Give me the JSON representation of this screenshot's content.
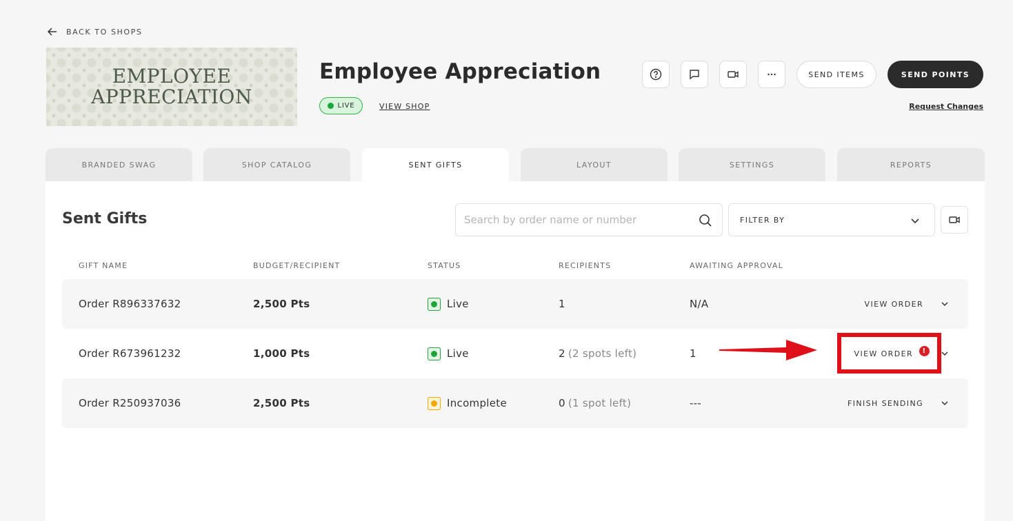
{
  "header": {
    "back_label": "BACK TO SHOPS",
    "banner_line1": "EMPLOYEE",
    "banner_line2": "APPRECIATION",
    "shop_title": "Employee Appreciation",
    "live_label": "LIVE",
    "view_shop_label": "VIEW SHOP",
    "send_items_label": "SEND ITEMS",
    "send_points_label": "SEND POINTS",
    "request_changes_label": "Request Changes",
    "icons": [
      "help-icon",
      "chat-icon",
      "video-icon",
      "more-icon"
    ]
  },
  "tabs": [
    {
      "label": "BRANDED SWAG"
    },
    {
      "label": "SHOP CATALOG"
    },
    {
      "label": "SENT GIFTS"
    },
    {
      "label": "LAYOUT"
    },
    {
      "label": "SETTINGS"
    },
    {
      "label": "REPORTS"
    }
  ],
  "active_tab": "SENT GIFTS",
  "panel": {
    "title": "Sent Gifts",
    "search_placeholder": "Search by order name or number",
    "filter_label": "FILTER BY"
  },
  "table": {
    "headers": [
      "GIFT NAME",
      "BUDGET/RECIPIENT",
      "STATUS",
      "RECIPIENTS",
      "AWAITING APPROVAL"
    ],
    "rows": [
      {
        "name": "Order R896337632",
        "budget": "2,500 Pts",
        "status": "Live",
        "recipients": "1",
        "recipients_note": "",
        "awaiting": "N/A",
        "action": "VIEW ORDER",
        "alert": ""
      },
      {
        "name": "Order R673961232",
        "budget": "1,000 Pts",
        "status": "Live",
        "recipients": "2",
        "recipients_note": "(2 spots left)",
        "awaiting": "1",
        "action": "VIEW ORDER",
        "alert": "!"
      },
      {
        "name": "Order R250937036",
        "budget": "2,500 Pts",
        "status": "Incomplete",
        "recipients": "0",
        "recipients_note": "(1 spot left)",
        "awaiting": "---",
        "action": "FINISH SENDING",
        "alert": ""
      }
    ]
  },
  "colors": {
    "live_green": "#1fa53b",
    "incomplete_amber": "#f5a800",
    "annotation_red": "#e0101a",
    "dark_button": "#2b2b2b"
  }
}
